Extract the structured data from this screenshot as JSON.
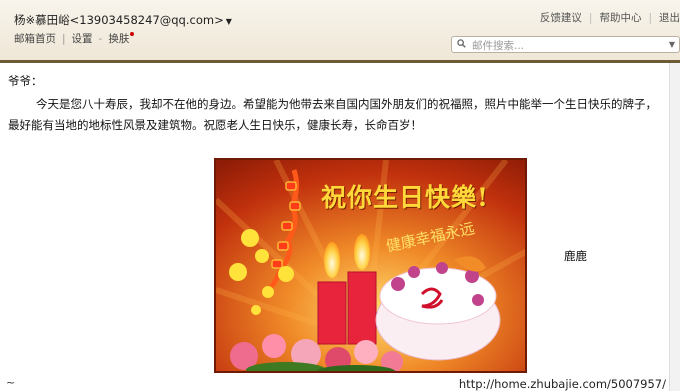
{
  "header": {
    "account": "杨※慕田峪<13903458247@qq.com>",
    "nav": [
      "邮箱首页",
      "设置",
      "换肤"
    ],
    "right_links": [
      "反馈建议",
      "帮助中心",
      "退出"
    ],
    "search_placeholder": "邮件搜索..."
  },
  "email": {
    "greeting": "爷爷：",
    "body": "今天是您八十寿辰，我却不在他的身边。希望能为他带去来自国内国外朋友们的祝福照，照片中能举一个生日快乐的牌子，最好能有当地的地标性风景及建筑物。祝愿老人生日快乐，健康长寿，长命百岁！",
    "signature": "鹿鹿",
    "card": {
      "title": "祝你生日快樂!",
      "subtitle": "健康幸福永远"
    }
  },
  "footer": {
    "tilde": "~",
    "url": "http://home.zhubajie.com/5007957/"
  },
  "colors": {
    "header_border": "#6e5a33",
    "card_bg": "#c1310d",
    "text": "#111111"
  }
}
